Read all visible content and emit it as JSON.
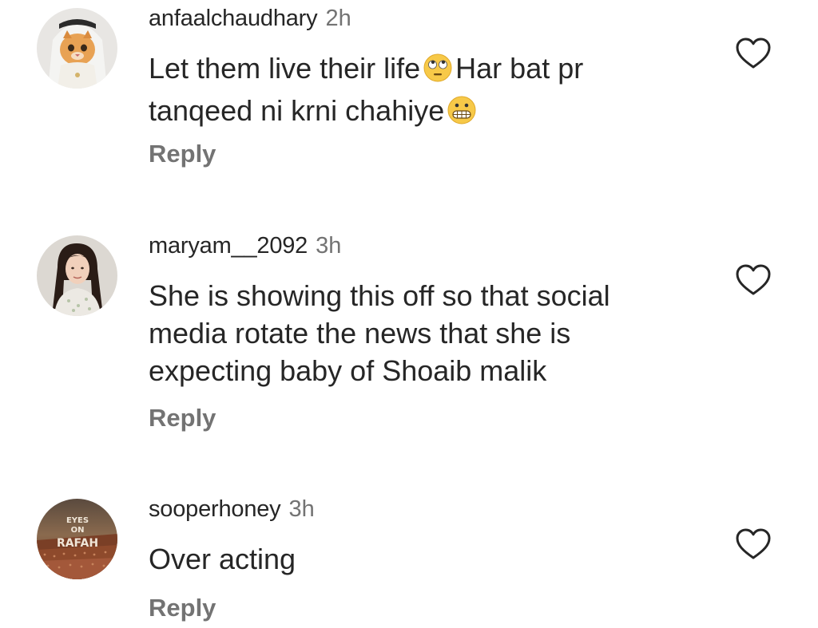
{
  "comments": [
    {
      "username": "anfaalchaudhary",
      "time": "2h",
      "text_part1": "Let them live their life",
      "emoji1": "face-with-rolling-eyes",
      "text_part2": "Har bat pr",
      "text_line2": "tanqeed ni krni chahiye",
      "emoji2": "grimacing-face",
      "reply_label": "Reply"
    },
    {
      "username": "maryam__2092",
      "time": "3h",
      "text": "She is showing this off so that social\nmedia rotate the news that she is\nexpecting baby of Shoaib malik",
      "reply_label": "Reply"
    },
    {
      "username": "sooperhoney",
      "time": "3h",
      "text": "Over acting",
      "reply_label": "Reply",
      "avatar_text": [
        "EYES",
        "ON",
        "RAFAH"
      ]
    }
  ],
  "colors": {
    "text": "#262626",
    "secondary": "#737373",
    "background": "#ffffff"
  },
  "icons": {
    "like": "heart-outline-icon"
  }
}
